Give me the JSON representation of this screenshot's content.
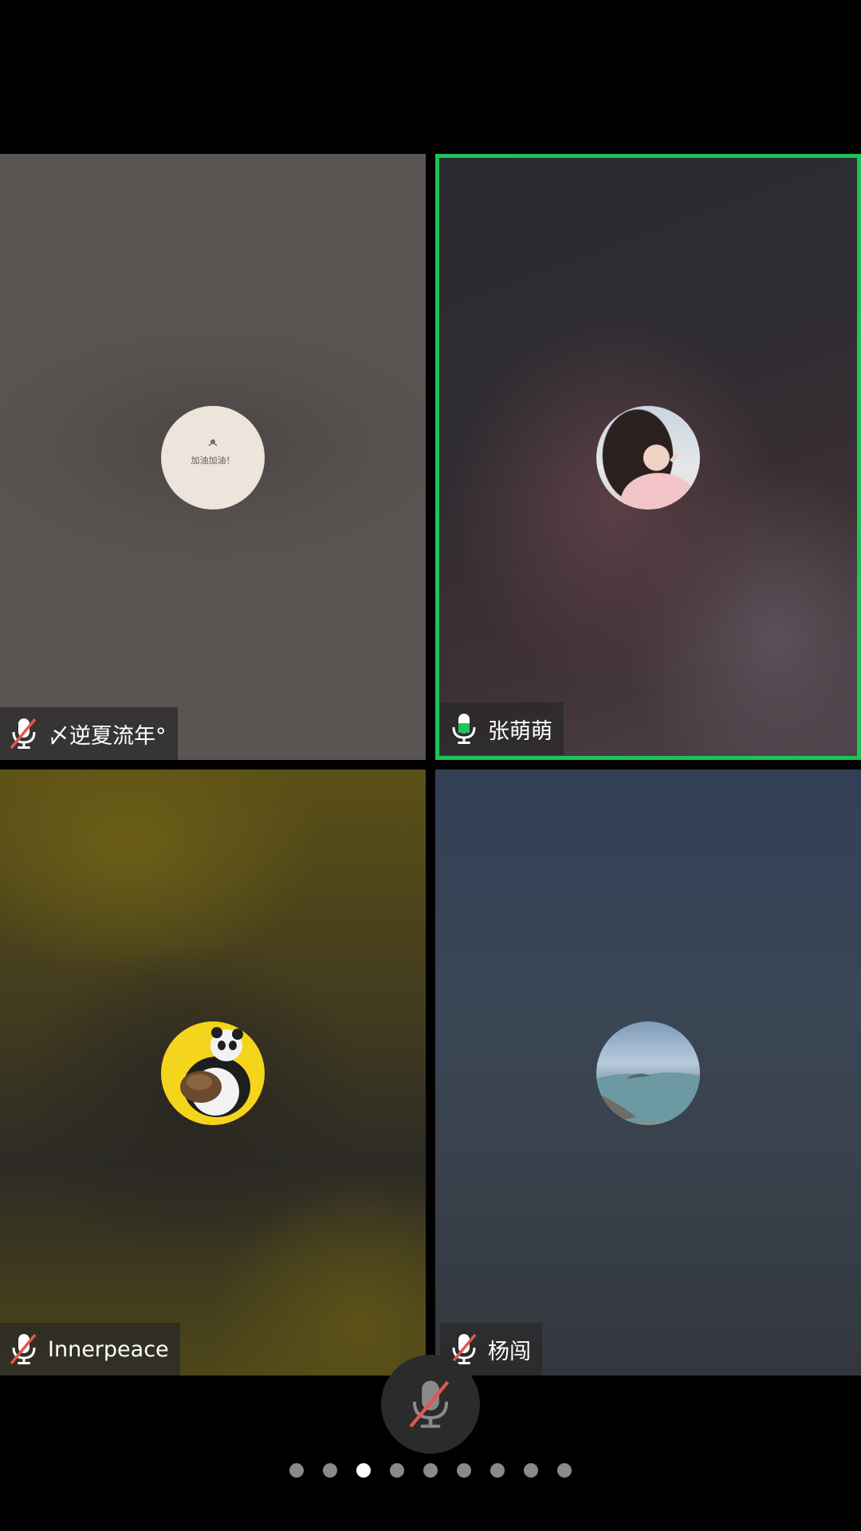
{
  "participants": [
    {
      "name": "〆逆夏流年°",
      "mic": "muted",
      "avatar_text": "加油加油！"
    },
    {
      "name": "张萌萌",
      "mic": "speaking",
      "active": true
    },
    {
      "name": "Innerpeace",
      "mic": "muted"
    },
    {
      "name": "杨闯",
      "mic": "muted"
    }
  ],
  "controls": {
    "mic_button": "muted"
  },
  "pagination": {
    "total": 9,
    "current": 3
  },
  "colors": {
    "active_border": "#1fc25a",
    "mute_slash": "#e0574f",
    "tag_bg": "#282828"
  }
}
